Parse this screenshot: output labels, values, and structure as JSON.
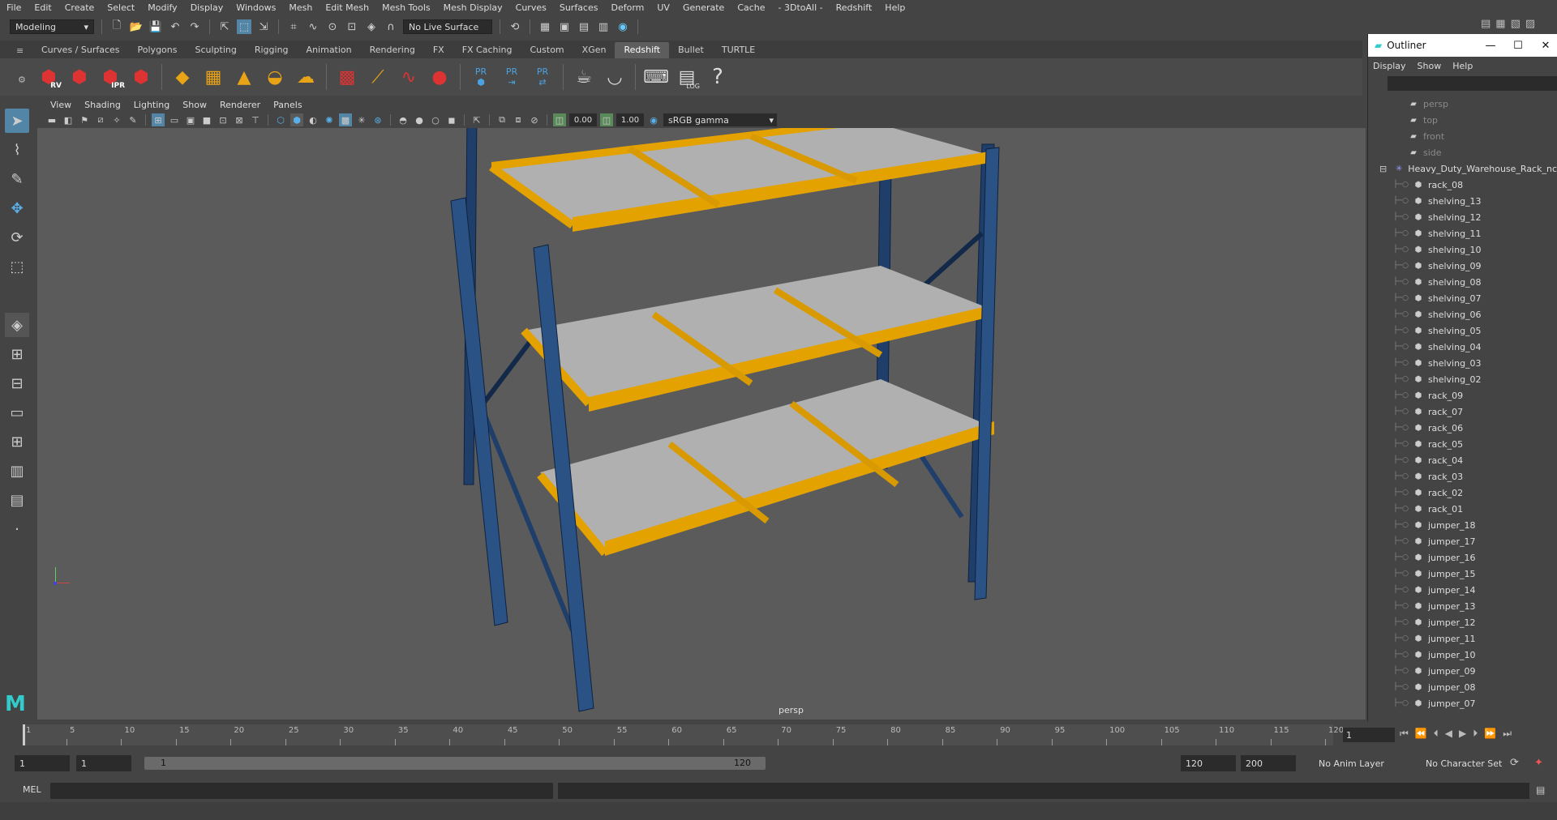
{
  "menubar": [
    "File",
    "Edit",
    "Create",
    "Select",
    "Modify",
    "Display",
    "Windows",
    "Mesh",
    "Edit Mesh",
    "Mesh Tools",
    "Mesh Display",
    "Curves",
    "Surfaces",
    "Deform",
    "UV",
    "Generate",
    "Cache",
    "- 3DtoAll -",
    "Redshift",
    "Help"
  ],
  "statusline": {
    "workspace": "Modeling",
    "live_surface": "No Live Surface"
  },
  "shelf_tabs": [
    "Curves / Surfaces",
    "Polygons",
    "Sculpting",
    "Rigging",
    "Animation",
    "Rendering",
    "FX",
    "FX Caching",
    "Custom",
    "XGen",
    "Redshift",
    "Bullet",
    "TURTLE"
  ],
  "active_shelf_tab": "Redshift",
  "shelf_labels": {
    "rv": "RV",
    "ipr": "IPR",
    "pr": "PR",
    "log": "LOG",
    "help": "?"
  },
  "panel_menu": [
    "View",
    "Shading",
    "Lighting",
    "Show",
    "Renderer",
    "Panels"
  ],
  "panel_tools": {
    "exposure": "0.00",
    "gamma_value": "1.00",
    "color_space": "sRGB gamma"
  },
  "viewport": {
    "camera": "persp"
  },
  "outliner": {
    "title": "Outliner",
    "menu": [
      "Display",
      "Show",
      "Help"
    ],
    "cameras": [
      "persp",
      "top",
      "front",
      "side"
    ],
    "root": "Heavy_Duty_Warehouse_Rack_nc",
    "items": [
      "rack_08",
      "shelving_13",
      "shelving_12",
      "shelving_11",
      "shelving_10",
      "shelving_09",
      "shelving_08",
      "shelving_07",
      "shelving_06",
      "shelving_05",
      "shelving_04",
      "shelving_03",
      "shelving_02",
      "rack_09",
      "rack_07",
      "rack_06",
      "rack_05",
      "rack_04",
      "rack_03",
      "rack_02",
      "rack_01",
      "jumper_18",
      "jumper_17",
      "jumper_16",
      "jumper_15",
      "jumper_14",
      "jumper_13",
      "jumper_12",
      "jumper_11",
      "jumper_10",
      "jumper_09",
      "jumper_08",
      "jumper_07"
    ]
  },
  "timeslider": {
    "ticks": [
      "1",
      "5",
      "10",
      "15",
      "20",
      "25",
      "30",
      "35",
      "40",
      "45",
      "50",
      "55",
      "60",
      "65",
      "70",
      "75",
      "80",
      "85",
      "90",
      "95",
      "100",
      "105",
      "110",
      "115",
      "120"
    ],
    "current_frame": "1"
  },
  "range": {
    "start": "1",
    "playback_start": "1",
    "bar_start": "1",
    "bar_end": "120",
    "playback_end": "120",
    "end": "200",
    "anim_layer": "No Anim Layer",
    "character_set": "No Character Set"
  },
  "cmdline": {
    "label": "MEL"
  }
}
